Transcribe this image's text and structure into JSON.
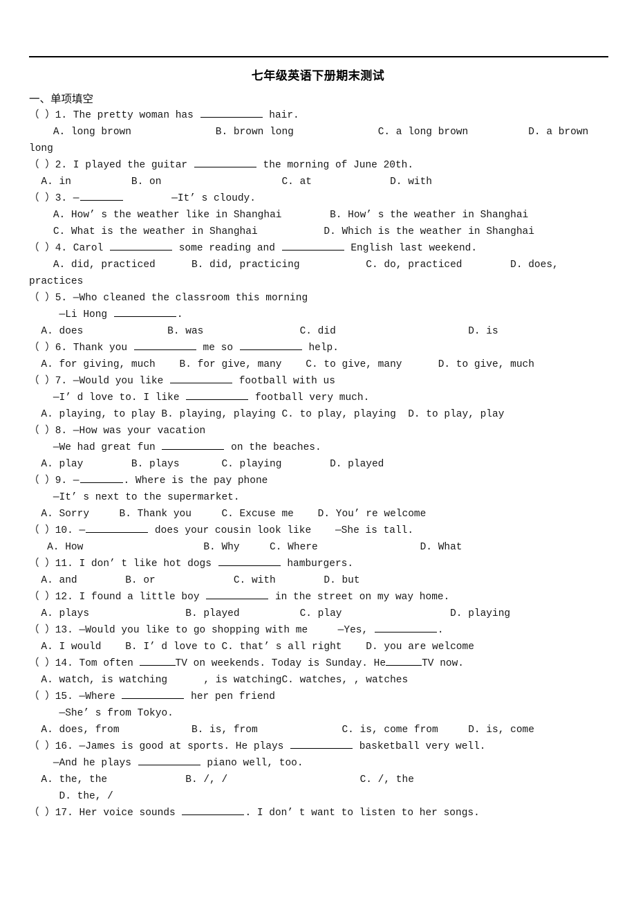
{
  "document": {
    "title": "七年级英语下册期末测试",
    "section_heading": "一、单项填空"
  },
  "questions": [
    {
      "stem_pre": "（ ）1. The pretty woman has ",
      "stem_post": " hair.",
      "blank": "long",
      "options_line": "    A. long brown              B. brown long              C. a long brown          D. a brown long"
    },
    {
      "stem_pre": "（ ）2. I played the guitar ",
      "stem_post": " the morning of June 20th.",
      "blank": "long",
      "options_line": "  A. in          B. on                    C. at             D. with"
    },
    {
      "stem_pre": "（ ）3. —",
      "stem_post": "        —It’ s cloudy.",
      "blank": "long",
      "options_line": "    A. How’ s the weather like in Shanghai        B. How’ s the weather in Shanghai\n    C. What is the weather in Shanghai           D. Which is the weather in Shanghai"
    },
    {
      "stem_pre": "（ ）4. Carol ",
      "stem_mid": " some reading and ",
      "stem_post": " English last weekend.",
      "blank": "long",
      "options_line": "    A. did, practiced      B. did, practicing           C. do, practiced        D. does, practices"
    },
    {
      "stem_line1": "（ ）5. —Who cleaned the classroom this morning",
      "stem_pre2": "     —Li Hong ",
      "stem_post2": ".",
      "options_line": "  A. does              B. was                C. did                      D. is"
    },
    {
      "stem_pre": "（ ）6. Thank you ",
      "stem_mid": " me so ",
      "stem_post": " help.",
      "options_line": "  A. for giving, much    B. for give, many    C. to give, many      D. to give, much"
    },
    {
      "stem_line1_pre": "（ ）7. —Would you like ",
      "stem_line1_post": " football with us",
      "stem_line2_pre": "    —I’ d love to. I like ",
      "stem_line2_post": " football very much.",
      "options_line": "  A. playing, to play B. playing, playing C. to play, playing  D. to play, play"
    },
    {
      "stem_line1": "（ ）8. —How was your vacation",
      "stem_line2_pre": "    —We had great fun ",
      "stem_line2_post": " on the beaches.",
      "options_line": "  A. play        B. plays       C. playing        D. played"
    },
    {
      "stem_line1_pre": "（ ）9. —",
      "stem_line1_post": ". Where is the pay phone",
      "stem_line2": "    —It’ s next to the supermarket.",
      "options_line": "  A. Sorry     B. Thank you     C. Excuse me    D. You’ re welcome"
    },
    {
      "stem_pre": "（ ）10. —",
      "stem_post": " does your cousin look like    —She is tall.",
      "options_line": "   A. How                    B. Why     C. Where                 D. What"
    },
    {
      "stem_pre": "（ ）11. I don’ t like hot dogs ",
      "stem_post": " hamburgers.",
      "options_line": "  A. and        B. or             C. with        D. but"
    },
    {
      "stem_pre": "（ ）12. I found a little boy ",
      "stem_post": " in the street on my way home.",
      "options_line": "  A. plays                B. played          C. play                  D. playing"
    },
    {
      "stem_pre": "（ ）13. —Would you like to go shopping with me     —Yes, ",
      "stem_post": ".",
      "options_line": "  A. I would    B. I’ d love to C. that’ s all right    D. you are welcome"
    },
    {
      "stem_pre": "（ ）14. Tom often ",
      "stem_mid": "TV on weekends. Today is Sunday. He",
      "stem_post": "TV now.",
      "options_line": "  A. watch, is watching      , is watchingC. watches, , watches"
    },
    {
      "stem_line1_pre": "（ ）15. —Where ",
      "stem_line1_post": " her pen friend",
      "stem_line2": "     —She’ s from Tokyo.",
      "options_line": "  A. does, from            B. is, from              C. is, come from     D. is, come"
    },
    {
      "stem_line1_pre": "（ ）16. —James is good at sports. He plays ",
      "stem_line1_post": " basketball very well.",
      "stem_line2_pre": "    —And he plays ",
      "stem_line2_post": " piano well, too.",
      "options_line": "  A. the, the             B. /, /                      C. /, the\n     D. the, /"
    },
    {
      "stem_pre": "（ ）17. Her voice sounds ",
      "stem_post": ". I don’ t want to listen to her songs."
    }
  ]
}
